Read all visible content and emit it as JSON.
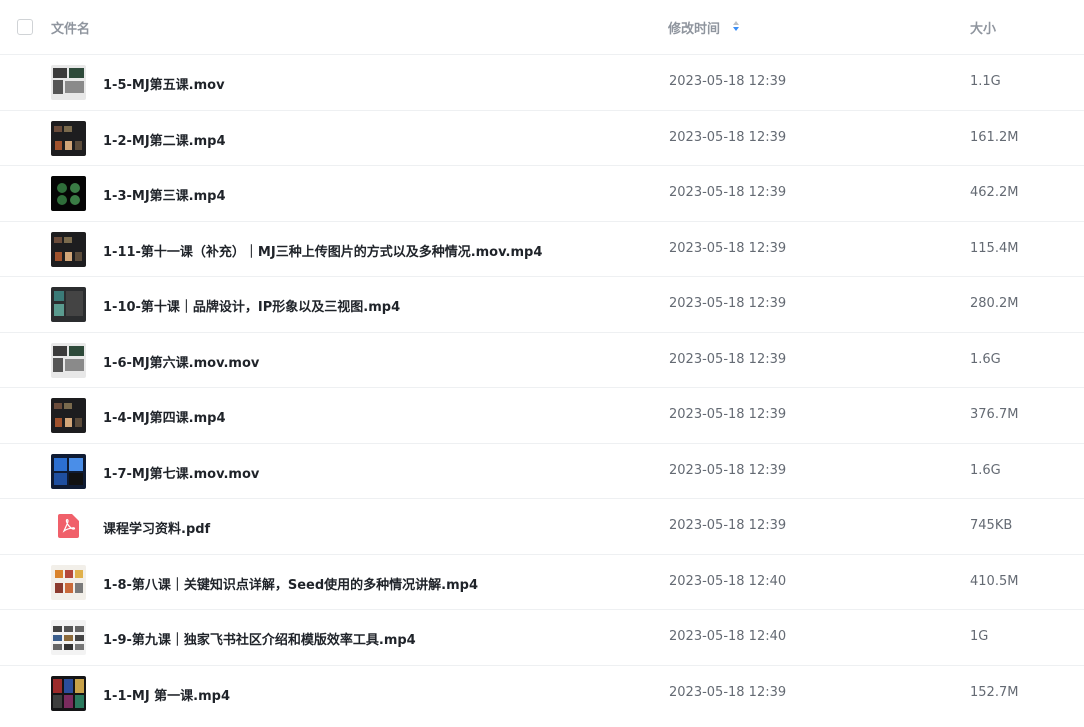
{
  "header": {
    "name_label": "文件名",
    "time_label": "修改时间",
    "size_label": "大小"
  },
  "files": [
    {
      "name": "1-5-MJ第五课.mov",
      "time": "2023-05-18 12:39",
      "size": "1.1G",
      "icon": "video-thumbnail-icon",
      "thumb": "light"
    },
    {
      "name": "1-2-MJ第二课.mp4",
      "time": "2023-05-18 12:39",
      "size": "161.2M",
      "icon": "video-thumbnail-icon",
      "thumb": "dark"
    },
    {
      "name": "1-3-MJ第三课.mp4",
      "time": "2023-05-18 12:39",
      "size": "462.2M",
      "icon": "video-thumbnail-icon",
      "thumb": "green"
    },
    {
      "name": "1-11-第十一课（补充）｜MJ三种上传图片的方式以及多种情况.mov.mp4",
      "time": "2023-05-18 12:39",
      "size": "115.4M",
      "icon": "video-thumbnail-icon",
      "thumb": "dark"
    },
    {
      "name": "1-10-第十课｜品牌设计，IP形象以及三视图.mp4",
      "time": "2023-05-18 12:39",
      "size": "280.2M",
      "icon": "video-thumbnail-icon",
      "thumb": "teal"
    },
    {
      "name": "1-6-MJ第六课.mov.mov",
      "time": "2023-05-18 12:39",
      "size": "1.6G",
      "icon": "video-thumbnail-icon",
      "thumb": "light"
    },
    {
      "name": "1-4-MJ第四课.mp4",
      "time": "2023-05-18 12:39",
      "size": "376.7M",
      "icon": "video-thumbnail-icon",
      "thumb": "dark"
    },
    {
      "name": "1-7-MJ第七课.mov.mov",
      "time": "2023-05-18 12:39",
      "size": "1.6G",
      "icon": "video-thumbnail-icon",
      "thumb": "blue"
    },
    {
      "name": "课程学习资料.pdf",
      "time": "2023-05-18 12:39",
      "size": "745KB",
      "icon": "pdf-icon",
      "thumb": "pdf"
    },
    {
      "name": "1-8-第八课｜关键知识点详解，Seed使用的多种情况讲解.mp4",
      "time": "2023-05-18 12:40",
      "size": "410.5M",
      "icon": "video-thumbnail-icon",
      "thumb": "orange"
    },
    {
      "name": "1-9-第九课｜独家飞书社区介绍和模版效率工具.mp4",
      "time": "2023-05-18 12:40",
      "size": "1G",
      "icon": "video-thumbnail-icon",
      "thumb": "grid"
    },
    {
      "name": "1-1-MJ 第一课.mp4",
      "time": "2023-05-18 12:39",
      "size": "152.7M",
      "icon": "video-thumbnail-icon",
      "thumb": "poster"
    }
  ],
  "colors": {
    "sort_active": "#3a8ef6",
    "sort_inactive": "#bbbfc4",
    "pdf_red": "#f0606a"
  }
}
